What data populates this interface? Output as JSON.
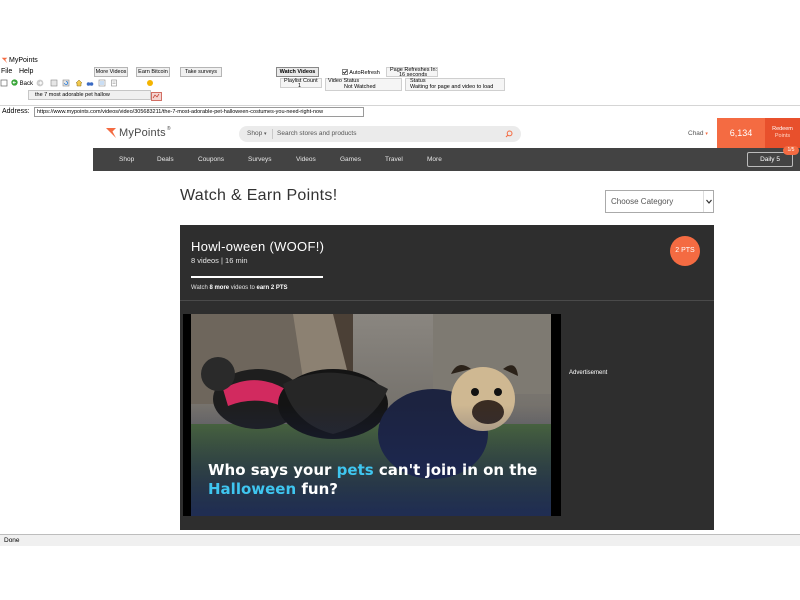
{
  "app": {
    "title": "MyPoints",
    "menus": [
      "File",
      "Help"
    ]
  },
  "toolbar": {
    "back_label": "Back",
    "buttons": [
      "More Videos",
      "Earn Bitcoin",
      "Take surveys",
      "Watch Videos"
    ],
    "autorefresh_label": "AutoRefresh",
    "autorefresh_checked": true,
    "refresh_label": "Page Refreshes In:",
    "refresh_value": "16 seconds",
    "playlist_count_label": "Playlist Count",
    "playlist_count_value": "1",
    "video_status_label": "Video Status",
    "video_status_value": "Not Watched",
    "status_label": "Status",
    "status_value": "Waiting for page and video to load"
  },
  "tab": {
    "title": "the 7 most adorable pet hallow"
  },
  "address": {
    "label": "Address:",
    "url": "https://www.mypoints.com/videos/video/305683211/the-7-most-adorable-pet-halloween-costumes-you-need-right-now"
  },
  "site": {
    "logo": "MyPoints",
    "logo_suffix": "®",
    "search": {
      "scope": "Shop",
      "placeholder": "Search stores and products"
    },
    "user": "Chad",
    "points": "6,134",
    "redeem": "Redeem",
    "redeem_sub": "Points",
    "nav": [
      "Shop",
      "Deals",
      "Coupons",
      "Surveys",
      "Videos",
      "Games",
      "Travel",
      "More"
    ],
    "daily": {
      "label": "Daily 5",
      "badge": "1/5"
    }
  },
  "main": {
    "heading": "Watch & Earn Points!",
    "category_placeholder": "Choose Category",
    "playlist": {
      "title": "Howl-oween (WOOF!)",
      "meta": "8 videos | 16 min",
      "progress_fraction": 1.0,
      "watch_prefix": "Watch ",
      "watch_count": "8 more",
      "watch_middle": " videos to ",
      "watch_earn": "earn 2 PTS",
      "points_badge": "2 PTS"
    },
    "video": {
      "caption_1": "Who says your ",
      "caption_hl_1": "pets",
      "caption_2": " can't join in on the ",
      "caption_hl_2": "Halloween",
      "caption_3": " fun?"
    },
    "ad_label": "Advertisement"
  },
  "status": {
    "text": "Done"
  },
  "colors": {
    "brand_orange": "#f46b42",
    "nav_dark": "#434343",
    "playlist_bg": "#2e2e2e",
    "caption_highlight": "#3fc6f0"
  }
}
